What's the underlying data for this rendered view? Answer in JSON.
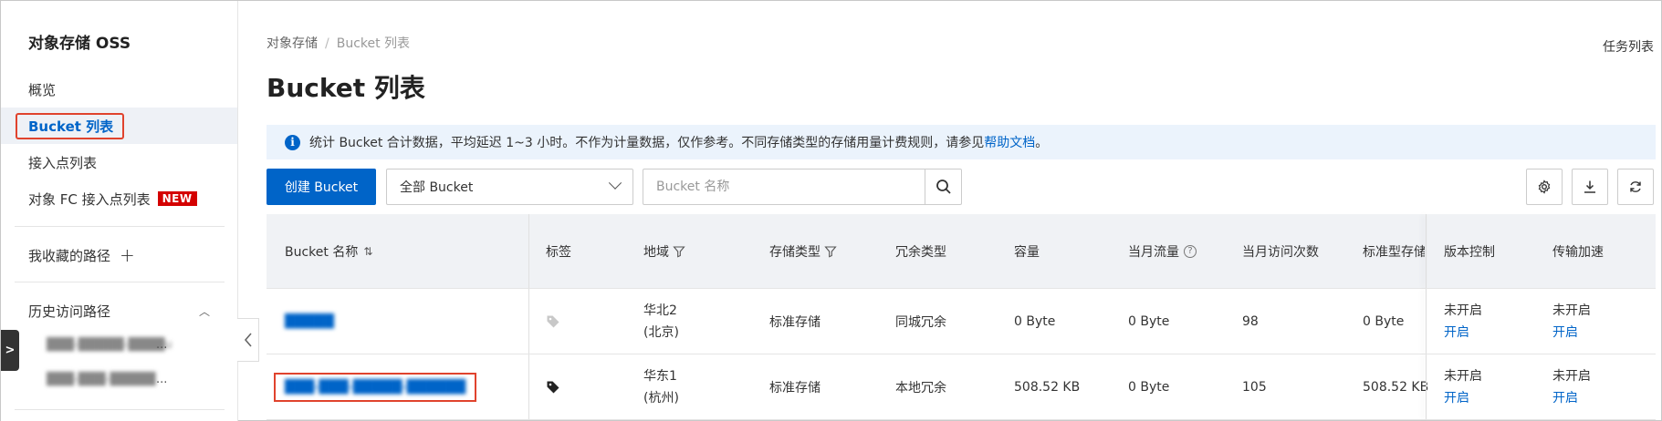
{
  "sidebar": {
    "title": "对象存储 OSS",
    "items": [
      {
        "label": "概览"
      },
      {
        "label": "Bucket 列表"
      },
      {
        "label": "接入点列表"
      },
      {
        "label": "对象 FC 接入点列表",
        "badge": "NEW"
      }
    ],
    "favorites_label": "我收藏的路径",
    "history_label": "历史访问路径",
    "history_items": [
      {
        "label": "███-█████-████u",
        "suffix": "..."
      },
      {
        "label": "███-███-█████",
        "suffix": "..."
      }
    ]
  },
  "breadcrumb": {
    "root": "对象存储",
    "separator": "/",
    "current": "Bucket 列表"
  },
  "task_list_label": "任务列表",
  "page_title": "Bucket 列表",
  "notice": {
    "text": "统计 Bucket 合计数据，平均延迟 1~3 小时。不作为计量数据，仅作参考。不同存储类型的存储用量计费规则，请参见",
    "link": "帮助文档",
    "end": "。"
  },
  "toolbar": {
    "create_label": "创建 Bucket",
    "filter_value": "全部 Bucket",
    "search_placeholder": "Bucket 名称"
  },
  "table": {
    "headers": {
      "name": "Bucket 名称",
      "tag": "标签",
      "region": "地域",
      "storage_class": "存储类型",
      "redundancy": "冗余类型",
      "capacity": "容量",
      "traffic": "当月流量",
      "visits": "当月访问次数",
      "standard": "标准型存储",
      "versioning": "版本控制",
      "acceleration": "传输加速"
    },
    "rows": [
      {
        "name": "█████",
        "region_line1": "华北2",
        "region_line2": "(北京)",
        "storage_class": "标准存储",
        "redundancy": "同城冗余",
        "capacity": "0 Byte",
        "traffic": "0 Byte",
        "visits": "98",
        "standard": "0 Byte",
        "versioning_status": "未开启",
        "versioning_action": "开启",
        "acceleration_status": "未开启",
        "acceleration_action": "开启"
      },
      {
        "name": "███-███-█████-██████",
        "region_line1": "华东1",
        "region_line2": "(杭州)",
        "storage_class": "标准存储",
        "redundancy": "本地冗余",
        "capacity": "508.52 KB",
        "traffic": "0 Byte",
        "visits": "105",
        "standard": "508.52 KB",
        "versioning_status": "未开启",
        "versioning_action": "开启",
        "acceleration_status": "未开启",
        "acceleration_action": "开启"
      }
    ]
  },
  "colors": {
    "primary": "#0064c8",
    "highlight": "#e0432d",
    "badge": "#d40000"
  }
}
